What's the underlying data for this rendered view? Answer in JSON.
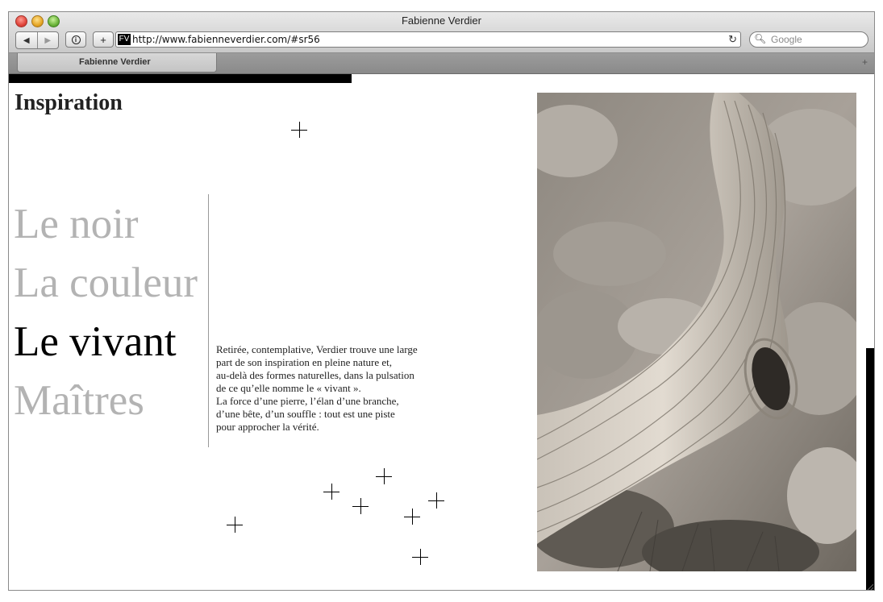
{
  "window": {
    "title": "Fabienne Verdier"
  },
  "toolbar": {
    "back_glyph": "◀",
    "forward_glyph": "▶",
    "add_glyph": "+",
    "info_glyph": "i",
    "favicon_text": "FV",
    "url": "http://www.fabienneverdier.com/#sr56",
    "reload_glyph": "↻",
    "search_placeholder": "Google",
    "search_icon_glyph": "🔍︎"
  },
  "tabs": [
    {
      "label": "Fabienne Verdier"
    }
  ],
  "page": {
    "heading": "Inspiration",
    "menu": [
      {
        "label": "Le noir",
        "active": false
      },
      {
        "label": "La couleur",
        "active": false
      },
      {
        "label": "Le vivant",
        "active": true
      },
      {
        "label": "Maîtres",
        "active": false
      }
    ],
    "description_lines": [
      "Retirée, contemplative, Verdier trouve une large",
      "part de son inspiration en pleine nature et,",
      "au-delà des formes naturelles, dans la pulsation",
      "de ce qu’elle nomme le « vivant ».",
      "La force d’une pierre, l’élan d’une branche,",
      "d’une bête, d’un souffle : tout est une piste",
      "pour approcher la vérité."
    ]
  },
  "colors": {
    "active_menu": "#000000",
    "inactive_menu": "#b3b3b3",
    "accent_bar": "#000000"
  },
  "icons": {
    "decorations": "cross-mark-icon",
    "photo": "tree-trunk-photo"
  }
}
